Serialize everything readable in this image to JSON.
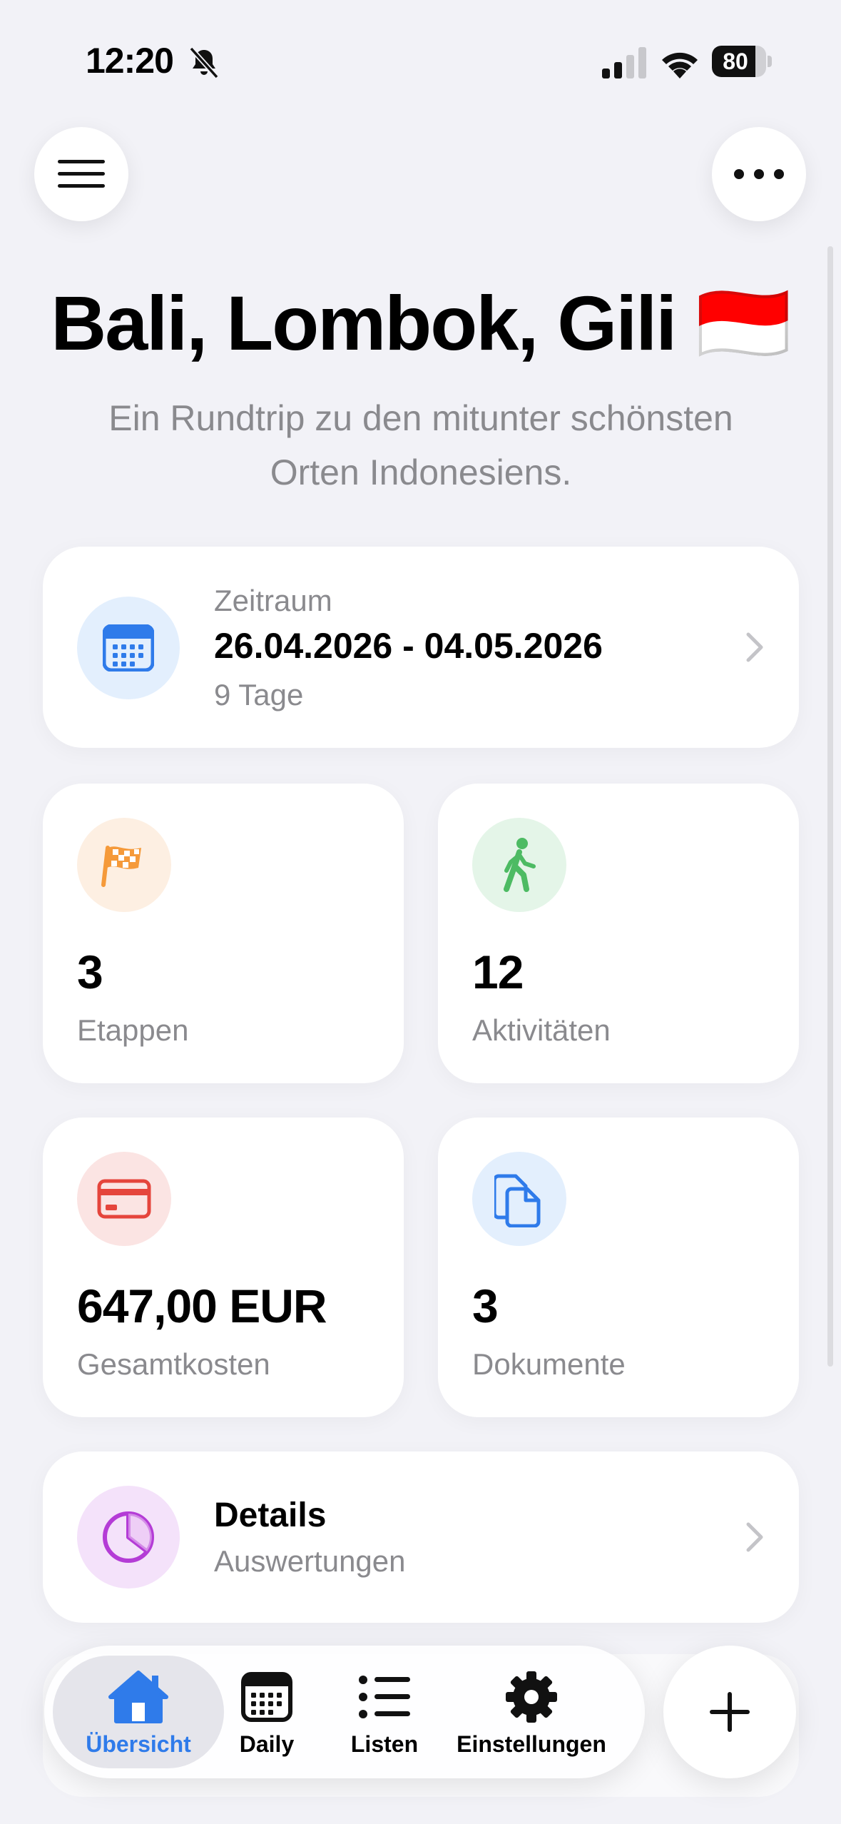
{
  "status_bar": {
    "time": "12:20",
    "battery": "80",
    "battery_level": 0.8
  },
  "header": {
    "title": "Bali, Lombok, Gili 🇮🇩",
    "subtitle": "Ein Rundtrip zu den mitunter schönsten Orten Indonesiens."
  },
  "period": {
    "label": "Zeitraum",
    "dates": "26.04.2026 - 04.05.2026",
    "duration": "9 Tage",
    "icon": "calendar-icon",
    "icon_color": "#2F7BEA",
    "icon_bg": "#E3EFFD"
  },
  "stats": [
    {
      "value": "3",
      "label": "Etappen",
      "icon": "checkered-flag-icon",
      "color": "#F59A3A",
      "bg": "#FDEFE2"
    },
    {
      "value": "12",
      "label": "Aktivitäten",
      "icon": "walking-person-icon",
      "color": "#4DBB63",
      "bg": "#E4F5E8"
    },
    {
      "value": "647,00 EUR",
      "label": "Gesamtkosten",
      "icon": "credit-card-icon",
      "color": "#E5453C",
      "bg": "#FBE4E3"
    },
    {
      "value": "3",
      "label": "Dokumente",
      "icon": "documents-icon",
      "color": "#2F7BEA",
      "bg": "#E3EFFD"
    }
  ],
  "details": {
    "title": "Details",
    "subtitle": "Auswertungen",
    "icon": "pie-chart-icon",
    "icon_color": "#B43CD6",
    "icon_bg": "#F4E2FA"
  },
  "tabs": [
    {
      "label": "Übersicht",
      "icon": "house-icon",
      "active": true
    },
    {
      "label": "Daily",
      "icon": "calendar-grid-icon",
      "active": false
    },
    {
      "label": "Listen",
      "icon": "list-icon",
      "active": false
    },
    {
      "label": "Einstellungen",
      "icon": "gear-icon",
      "active": false
    }
  ],
  "colors": {
    "accent": "#2F7BEA",
    "background": "#F2F2F7"
  }
}
